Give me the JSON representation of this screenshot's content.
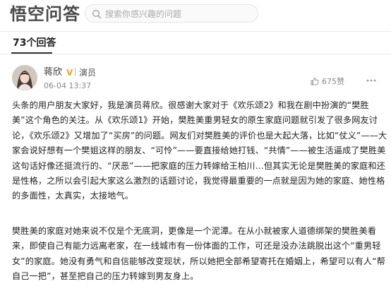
{
  "header": {
    "logo": "悟空问答",
    "search_placeholder": "搜索你感兴趣的问题"
  },
  "tabs": {
    "answers_count": "73个回答"
  },
  "answer": {
    "author_name": "蒋欣",
    "verified_badge": "V",
    "author_title": "演员",
    "post_time": "06-04 13:37",
    "likes": "675赞",
    "paragraphs": [
      "头条的用户朋友大家好，我是演员蒋欣。很感谢大家对于《欢乐颂2》和我在剧中扮演的“樊胜美”这个角色的关注。从《欢乐颂1》开始，樊胜美重男轻女的原生家庭问题就引发了很多网友讨论，《欢乐颂2》又增加了“买房”的问题。网友们对樊胜美的评价也是大起大落，比如“仗义”——大家会说好想有一个樊姐这样的朋友、“可怜”——要直接给她打钱、“共情”——被生活逼成了樊胜美这句话好像还挺流行的、“厌恶”——把家庭的压力转嫁给王柏川…但其实无论是樊胜美的家庭和还是性格，之所以会引起大家这么激烈的话题讨论，我觉得最重要的一点就是因为她的家庭、她性格的多面性，太真实，太接地气。",
      "樊胜美的家庭对她来说不仅是个无底洞，更像是一个泥潭。在从小就被家人道德绑架的樊胜美看来，即使自己有能力远离老家，在一线城市有一份体面的工作，可还是没办法跳脱出这个“重男轻女”的家庭。她没有勇气和自信能够改变现状，所以她把全部希望寄托在婚姻上，希望可以有人“帮自己一把”，甚至把自己的压力转嫁到男友身上。"
    ]
  },
  "icons": {
    "search": "search-icon",
    "like": "thumbs-up-icon",
    "more": "more-dots-icon"
  },
  "colors": {
    "badge": "#f5a623",
    "text": "#222222",
    "meta": "#888888"
  }
}
